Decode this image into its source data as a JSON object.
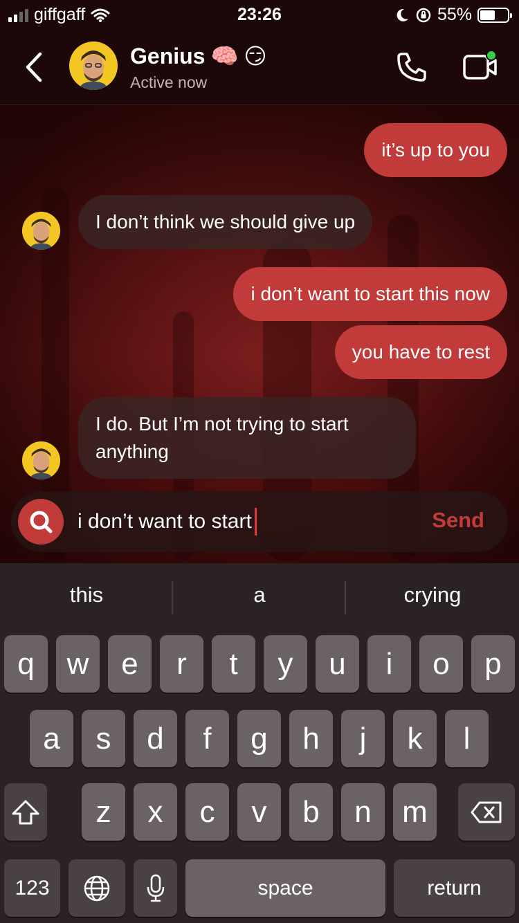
{
  "status_bar": {
    "carrier": "giffgaff",
    "time": "23:26",
    "battery": "55%",
    "battery_level": 0.55
  },
  "header": {
    "contact_name": "Genius",
    "contact_emojis": [
      "🧠",
      "😏"
    ],
    "contact_status": "Active now",
    "icons": [
      "back-chevron-icon",
      "phone-icon",
      "video-call-icon"
    ]
  },
  "messages": [
    {
      "direction": "out",
      "text": "it’s up to you"
    },
    {
      "direction": "in",
      "text": "I don’t think we should give up"
    },
    {
      "direction": "out",
      "text": "i don’t want to start this now"
    },
    {
      "direction": "out",
      "text": "you have to rest"
    },
    {
      "direction": "in",
      "text": "I do. But I’m not trying to start anything"
    }
  ],
  "composer": {
    "value": "i don’t want to start",
    "send_label": "Send"
  },
  "keyboard": {
    "suggestions": [
      "this",
      "a",
      "crying"
    ],
    "row1": [
      "q",
      "w",
      "e",
      "r",
      "t",
      "y",
      "u",
      "i",
      "o",
      "p"
    ],
    "row2": [
      "a",
      "s",
      "d",
      "f",
      "g",
      "h",
      "j",
      "k",
      "l"
    ],
    "row3": [
      "z",
      "x",
      "c",
      "v",
      "b",
      "n",
      "m"
    ],
    "numbers_label": "123",
    "space_label": "space",
    "return_label": "return"
  },
  "colors": {
    "accent": "#c23b3b",
    "header_bg": "#1c0808",
    "keyboard_bg": "#2b2224",
    "key_bg": "#6b6264"
  }
}
